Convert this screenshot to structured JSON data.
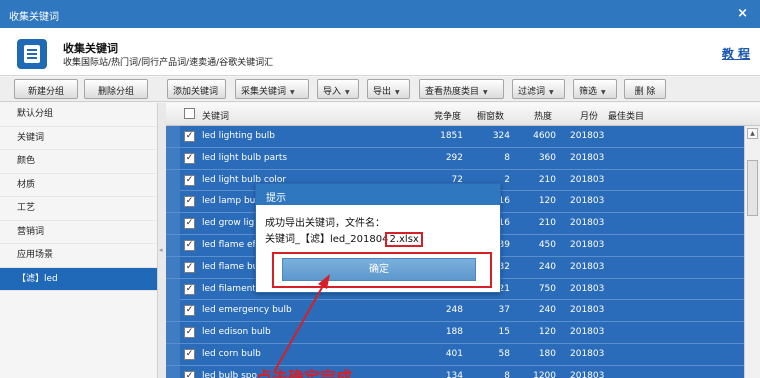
{
  "window": {
    "title": "收集关键词",
    "close_glyph": "×"
  },
  "header": {
    "title": "收集关键词",
    "subtitle": "收集国际站/热门词/同行产品词/速卖通/谷歌关键词汇",
    "help_link": "教 程",
    "logo_icon": "document-list-icon"
  },
  "left_toolbar": {
    "new_group": "新建分组",
    "delete_group": "删除分组"
  },
  "toolbar": {
    "add_keyword": "添加关键词",
    "collect_keyword": "采集关键词",
    "import": "导入",
    "export": "导出",
    "view_hot_category": "查看热度类目",
    "filter_words": "过滤词",
    "screen": "筛选",
    "delete": "删 除"
  },
  "sidebar": {
    "items": [
      {
        "label": "默认分组",
        "active": false
      },
      {
        "label": "关键词",
        "active": false
      },
      {
        "label": "颜色",
        "active": false
      },
      {
        "label": "材质",
        "active": false
      },
      {
        "label": "工艺",
        "active": false
      },
      {
        "label": "营销词",
        "active": false
      },
      {
        "label": "应用场景",
        "active": false
      },
      {
        "label": "【滤】led",
        "active": true
      }
    ]
  },
  "table": {
    "headers": {
      "keyword": "关键词",
      "competition": "竞争度",
      "window_count": "橱窗数",
      "heat": "热度",
      "month": "月份",
      "best_category": "最佳类目"
    },
    "rows": [
      {
        "checked": "✓",
        "keyword": "led lighting bulb",
        "competition": "1851",
        "window_count": "324",
        "heat": "4600",
        "month": "201803"
      },
      {
        "checked": "✓",
        "keyword": "led light bulb parts",
        "competition": "292",
        "window_count": "8",
        "heat": "360",
        "month": "201803"
      },
      {
        "checked": "✓",
        "keyword": "led light bulb color",
        "competition": "72",
        "window_count": "2",
        "heat": "210",
        "month": "201803"
      },
      {
        "checked": "✓",
        "keyword": "led lamp bul",
        "competition": "",
        "window_count": "16",
        "heat": "120",
        "month": "201803"
      },
      {
        "checked": "✓",
        "keyword": "led grow ligl",
        "competition": "",
        "window_count": "16",
        "heat": "210",
        "month": "201803"
      },
      {
        "checked": "✓",
        "keyword": "led flame eff",
        "competition": "",
        "window_count": "39",
        "heat": "450",
        "month": "201803"
      },
      {
        "checked": "✓",
        "keyword": "led flame bul",
        "competition": "",
        "window_count": "32",
        "heat": "240",
        "month": "201803"
      },
      {
        "checked": "✓",
        "keyword": "led filament bulb",
        "competition": "",
        "window_count": "121",
        "heat": "750",
        "month": "201803"
      },
      {
        "checked": "✓",
        "keyword": "led emergency bulb",
        "competition": "248",
        "window_count": "37",
        "heat": "240",
        "month": "201803"
      },
      {
        "checked": "✓",
        "keyword": "led edison bulb",
        "competition": "188",
        "window_count": "15",
        "heat": "120",
        "month": "201803"
      },
      {
        "checked": "✓",
        "keyword": "led corn bulb",
        "competition": "401",
        "window_count": "58",
        "heat": "180",
        "month": "201803"
      },
      {
        "checked": "✓",
        "keyword": "led bulb spo",
        "competition": "134",
        "window_count": "8",
        "heat": "1200",
        "month": "201803"
      }
    ]
  },
  "dialog": {
    "title": "提示",
    "message_line1": "成功导出关键词，文件名：",
    "message_line2_prefix": "关键词_【滤】led_201804",
    "message_line2_highlight": "2.xlsx",
    "ok_button": "确定"
  },
  "annotation": {
    "text": "点击确定完成",
    "color": "#d61f26"
  },
  "colors": {
    "titlebar": "#2f78bf",
    "selection": "#2a6cb9",
    "highlight": "#d61f26"
  }
}
